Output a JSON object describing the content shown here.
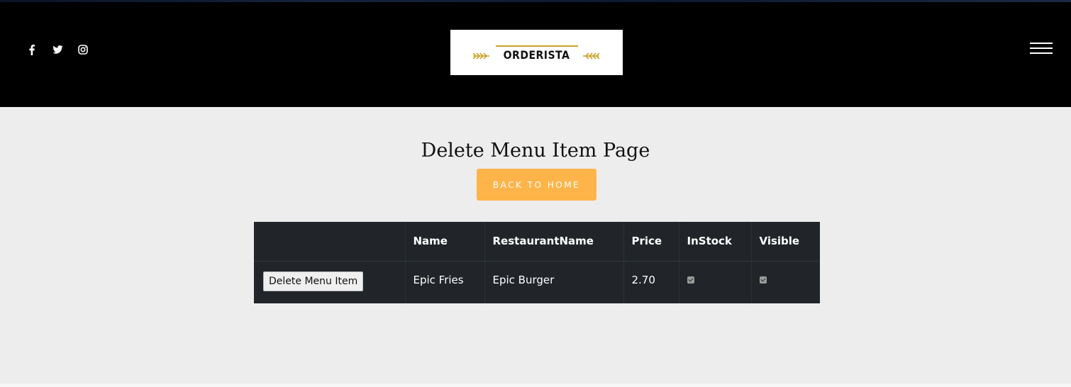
{
  "header": {
    "social_icons": [
      "facebook-icon",
      "twitter-icon",
      "instagram-icon"
    ],
    "logo_text": "ORDERISTA",
    "logo_accent_color": "#c9a227",
    "menu_icon": "hamburger-icon"
  },
  "main": {
    "title": "Delete Menu Item Page",
    "back_button_label": "BACK TO HOME",
    "back_button_color": "#ffb44a"
  },
  "table": {
    "columns": [
      "",
      "Name",
      "RestaurantName",
      "Price",
      "InStock",
      "Visible"
    ],
    "rows": [
      {
        "action_label": "Delete Menu Item",
        "name": "Epic Fries",
        "restaurant_name": "Epic Burger",
        "price": "2.70",
        "in_stock": true,
        "visible": true
      }
    ]
  }
}
